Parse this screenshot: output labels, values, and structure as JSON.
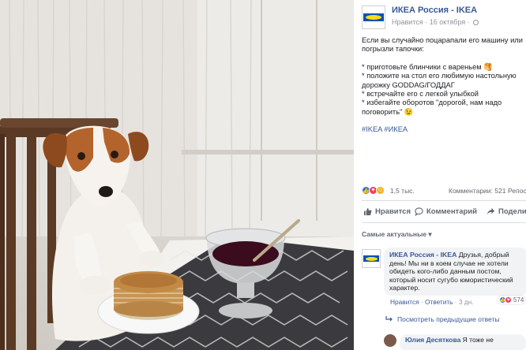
{
  "post": {
    "page_name": "ИКЕА Россия - IKEA",
    "liked_label": "Нравится",
    "date": "16 октября",
    "body_lines": [
      "Если вы случайно поцарапали его машину или",
      "погрызли тапочки:"
    ],
    "list_lines": [
      "* приготовьте блинчики с вареньем 🥞",
      "* положите на стол его любимую настольную",
      "дорожку GODDAG/ГОДДАГ",
      "* встречайте его с легкой улыбкой",
      "* избегайте оборотов \"дорогой, нам надо",
      "поговорить\" 😉"
    ],
    "hashtags": "#IKEA #ИКЕА"
  },
  "stats": {
    "reactions": "1,5 тыс.",
    "comments": "Комментарии: 521",
    "reposts": "Репосты"
  },
  "actions": {
    "like": "Нравится",
    "comment": "Комментарий",
    "share": "Поделиться"
  },
  "comments_sort": "Самые актуальные ▾",
  "top_comment": {
    "author": "ИКЕА Россия - IKEA",
    "text": " Друзья, добрый день! Мы ни в коем случае не хотели обидеть кого-либо данным постом, который носит сугубо юмористический характер.",
    "like_label": "Нравится",
    "reply_label": "Ответить",
    "time": "3 дн.",
    "reaction_count": "574"
  },
  "prev_replies": "Посмотреть предыдущие ответы",
  "next_comment": {
    "author": "Юлия Десяткова",
    "text": " Я тоже не"
  },
  "colors": {
    "link_blue": "#385898",
    "ikea_blue": "#0051ba",
    "ikea_yellow": "#ffda1a"
  }
}
